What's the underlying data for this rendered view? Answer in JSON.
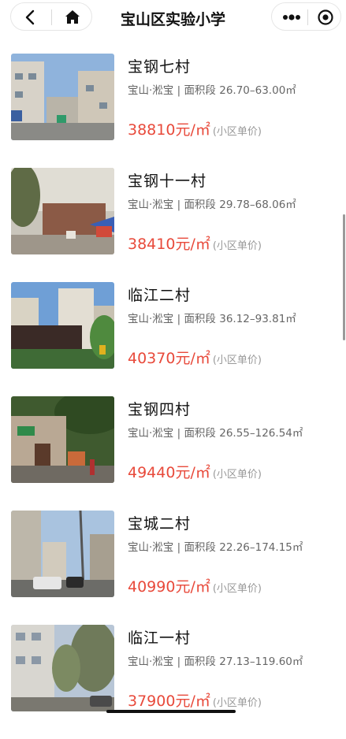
{
  "nav": {
    "title": "宝山区实验小学",
    "icons": {
      "back": "chevron-left-icon",
      "home": "home-icon",
      "more": "more-dots-icon",
      "close": "target-circle-icon"
    }
  },
  "listings": [
    {
      "name": "宝钢七村",
      "location": "宝山·淞宝",
      "area_label": "面积段",
      "area_range": "26.70–63.00㎡",
      "price": "38810元/㎡",
      "price_note": "(小区单价)"
    },
    {
      "name": "宝钢十一村",
      "location": "宝山·淞宝",
      "area_label": "面积段",
      "area_range": "29.78–68.06㎡",
      "price": "38410元/㎡",
      "price_note": "(小区单价)"
    },
    {
      "name": "临江二村",
      "location": "宝山·淞宝",
      "area_label": "面积段",
      "area_range": "36.12–93.81㎡",
      "price": "40370元/㎡",
      "price_note": "(小区单价)"
    },
    {
      "name": "宝钢四村",
      "location": "宝山·淞宝",
      "area_label": "面积段",
      "area_range": "26.55–126.54㎡",
      "price": "49440元/㎡",
      "price_note": "(小区单价)"
    },
    {
      "name": "宝城二村",
      "location": "宝山·淞宝",
      "area_label": "面积段",
      "area_range": "22.26–174.15㎡",
      "price": "40990元/㎡",
      "price_note": "(小区单价)"
    },
    {
      "name": "临江一村",
      "location": "宝山·淞宝",
      "area_label": "面积段",
      "area_range": "27.13–119.60㎡",
      "price": "37900元/㎡",
      "price_note": "(小区单价)"
    }
  ],
  "colors": {
    "price": "#e84a3b",
    "meta": "#666666",
    "title": "#111111"
  }
}
